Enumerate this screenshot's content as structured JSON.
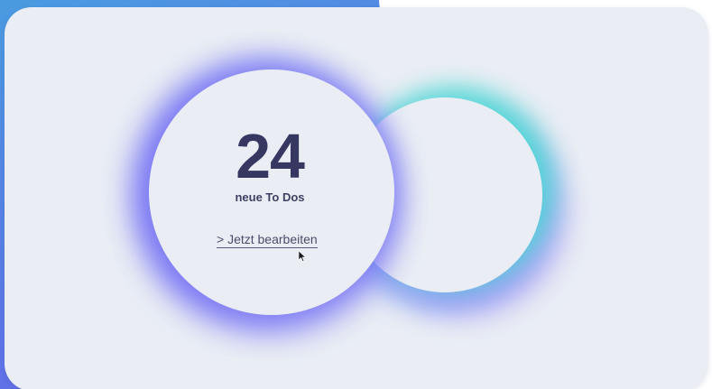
{
  "widget": {
    "count": "24",
    "subtitle": "neue To Dos",
    "link_label": "> Jetzt bearbeiten"
  },
  "colors": {
    "background_gradient_start": "#4a9be0",
    "background_gradient_end": "#6b63e8",
    "card_background": "#eaeef4",
    "count_text": "#363862",
    "glow_purple": "#736ef5",
    "glow_teal": "#46dcd2"
  },
  "icons": {
    "cursor": "mouse-pointer-icon"
  }
}
